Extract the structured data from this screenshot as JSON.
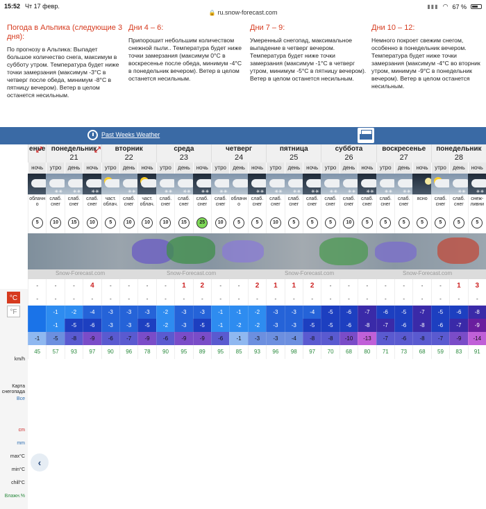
{
  "status": {
    "time": "15:52",
    "date": "Чт 17 февр.",
    "url": "ru.snow-forecast.com",
    "battery": "67 %",
    "battery_level": 0.67
  },
  "forecast": [
    {
      "title": "Погода в Альпика (следующие 3 дня):",
      "text": "По прогнозу в Альпика: Выпадет большое количество снега, максимум в субботу утром. Температура будет ниже точки замерзания (максимум -3°C в четверг после обеда, минимум -8°C в пятницу вечером). Ветер в целом останется несильным."
    },
    {
      "title": "Дни 4 – 6:",
      "text": "Припорошит небольшим количеством снежной пыли.. Температура будет ниже точки замерзания (максимум 0°C в воскресенье после обеда, минимум -4°C в понедельник вечером). Ветер в целом останется несильным."
    },
    {
      "title": "Дни 7 – 9:",
      "text": "Умеренный снегопад, максимальное выпадение в четверг вечером. Температура будет ниже точки замерзания (максимум -1°C в четверг утром, минимум -5°C в пятницу вечером). Ветер в целом останется несильным."
    },
    {
      "title": "Дни 10 – 12:",
      "text": "Немного покроет свежим снегом, особенно в понедельник вечером. Температура будет ниже точки замерзания (максимум -4°C во вторник утром, минимум -9°C в понедельник вечером). Ветер в целом останется несильным."
    }
  ],
  "bar": {
    "past_weeks": "Past Weeks Weather"
  },
  "units": {
    "c": "°C",
    "f": "°F"
  },
  "labels": {
    "wind": "km/h",
    "map": "Карта снегопада",
    "map_all": "Все",
    "snow_cm": "cm",
    "rain_mm": "mm",
    "tmax": "max°C",
    "tmin": "min°C",
    "chill": "chill°C",
    "humidity": "Влажн.%"
  },
  "snowfc_label": "Snow-Forecast.com",
  "days": [
    {
      "name": "енье",
      "num": ""
    },
    {
      "name": "понедельник",
      "num": "21"
    },
    {
      "name": "вторник",
      "num": "22"
    },
    {
      "name": "среда",
      "num": "23"
    },
    {
      "name": "четверг",
      "num": "24"
    },
    {
      "name": "пятница",
      "num": "25"
    },
    {
      "name": "суббота",
      "num": "26"
    },
    {
      "name": "воскресенье",
      "num": "27"
    },
    {
      "name": "понедельник",
      "num": "28"
    }
  ],
  "cols": [
    {
      "tod": "ночь",
      "desc": "облачн о",
      "wind": "5",
      "snow": "-",
      "mm": "-",
      "tmax": "",
      "tmin": "",
      "chill": "-1",
      "hum": "45",
      "kind": "night"
    },
    {
      "tod": "утро",
      "desc": "слаб. снег",
      "wind": "10",
      "snow": "-",
      "mm": "-",
      "tmax": "-1",
      "tmin": "-1",
      "chill": "-5",
      "hum": "57",
      "kind": "snow"
    },
    {
      "tod": "день",
      "desc": "слаб. снег",
      "wind": "15",
      "snow": "-",
      "mm": "-",
      "tmax": "-2",
      "tmin": "-5",
      "chill": "-8",
      "hum": "93",
      "kind": "snow"
    },
    {
      "tod": "ночь",
      "desc": "слаб. снег",
      "wind": "10",
      "snow": "4",
      "mm": "-",
      "tmax": "-4",
      "tmin": "-6",
      "chill": "-9",
      "hum": "97",
      "kind": "nightsnow"
    },
    {
      "tod": "утро",
      "desc": "част. облач.",
      "wind": "5",
      "snow": "-",
      "mm": "-",
      "tmax": "-3",
      "tmin": "-3",
      "chill": "-6",
      "hum": "90",
      "kind": "sun"
    },
    {
      "tod": "день",
      "desc": "слаб. снег",
      "wind": "10",
      "snow": "-",
      "mm": "-",
      "tmax": "-3",
      "tmin": "-3",
      "chill": "-7",
      "hum": "96",
      "kind": "snow"
    },
    {
      "tod": "ночь",
      "desc": "част. облач.",
      "wind": "10",
      "snow": "-",
      "mm": "-",
      "tmax": "-3",
      "tmin": "-5",
      "chill": "-9",
      "hum": "78",
      "kind": "nightsun"
    },
    {
      "tod": "утро",
      "desc": "слаб. снег",
      "wind": "10",
      "snow": "-",
      "mm": "-",
      "tmax": "-2",
      "tmin": "-2",
      "chill": "-6",
      "hum": "90",
      "kind": "snow"
    },
    {
      "tod": "день",
      "desc": "слаб. снег",
      "wind": "15",
      "snow": "1",
      "mm": "-",
      "tmax": "-3",
      "tmin": "-3",
      "chill": "-9",
      "hum": "95",
      "kind": "snow"
    },
    {
      "tod": "ночь",
      "desc": "слаб. снег",
      "wind": "25",
      "snow": "2",
      "mm": "-",
      "tmax": "-3",
      "tmin": "-5",
      "chill": "-9",
      "hum": "89",
      "kind": "nightsnow"
    },
    {
      "tod": "утро",
      "desc": "слаб. снег",
      "wind": "10",
      "snow": "-",
      "mm": "-",
      "tmax": "-1",
      "tmin": "-1",
      "chill": "-6",
      "hum": "95",
      "kind": "snow"
    },
    {
      "tod": "день",
      "desc": "облачн о",
      "wind": "5",
      "snow": "-",
      "mm": "-",
      "tmax": "-1",
      "tmin": "-2",
      "chill": "-1",
      "hum": "85",
      "kind": "cloud"
    },
    {
      "tod": "ночь",
      "desc": "слаб. снег",
      "wind": "5",
      "snow": "2",
      "mm": "-",
      "tmax": "-2",
      "tmin": "-2",
      "chill": "-3",
      "hum": "93",
      "kind": "nightsnow"
    },
    {
      "tod": "утро",
      "desc": "слаб. снег",
      "wind": "10",
      "snow": "1",
      "mm": "-",
      "tmax": "-3",
      "tmin": "-3",
      "chill": "-3",
      "hum": "96",
      "kind": "snow"
    },
    {
      "tod": "день",
      "desc": "слаб. снег",
      "wind": "5",
      "snow": "1",
      "mm": "-",
      "tmax": "-3",
      "tmin": "-3",
      "chill": "-4",
      "hum": "98",
      "kind": "snow"
    },
    {
      "tod": "ночь",
      "desc": "слаб. снег",
      "wind": "5",
      "snow": "2",
      "mm": "-",
      "tmax": "-4",
      "tmin": "-5",
      "chill": "-8",
      "hum": "97",
      "kind": "nightsnow"
    },
    {
      "tod": "утро",
      "desc": "слаб. снег",
      "wind": "5",
      "snow": "-",
      "mm": "-",
      "tmax": "-5",
      "tmin": "-5",
      "chill": "-8",
      "hum": "70",
      "kind": "snow"
    },
    {
      "tod": "день",
      "desc": "слаб. снег",
      "wind": "10",
      "snow": "-",
      "mm": "-",
      "tmax": "-6",
      "tmin": "-6",
      "chill": "-10",
      "hum": "68",
      "kind": "snow"
    },
    {
      "tod": "ночь",
      "desc": "слаб. снег",
      "wind": "5",
      "snow": "-",
      "mm": "-",
      "tmax": "-7",
      "tmin": "-8",
      "chill": "-13",
      "hum": "80",
      "kind": "nightsnow"
    },
    {
      "tod": "утро",
      "desc": "слаб. снег",
      "wind": "5",
      "snow": "-",
      "mm": "-",
      "tmax": "-6",
      "tmin": "-7",
      "chill": "-7",
      "hum": "71",
      "kind": "snow"
    },
    {
      "tod": "день",
      "desc": "слаб. снег",
      "wind": "5",
      "snow": "-",
      "mm": "-",
      "tmax": "-5",
      "tmin": "-6",
      "chill": "-6",
      "hum": "73",
      "kind": "snow"
    },
    {
      "tod": "ночь",
      "desc": "ясно",
      "wind": "5",
      "snow": "-",
      "mm": "-",
      "tmax": "-7",
      "tmin": "-8",
      "chill": "-8",
      "hum": "68",
      "kind": "clearnight"
    },
    {
      "tod": "утро",
      "desc": "слаб. снег",
      "wind": "5",
      "snow": "-",
      "mm": "-",
      "tmax": "-5",
      "tmin": "-6",
      "chill": "-7",
      "hum": "59",
      "kind": "sun"
    },
    {
      "tod": "день",
      "desc": "слаб. снег",
      "wind": "5",
      "snow": "1",
      "mm": "-",
      "tmax": "-6",
      "tmin": "-7",
      "chill": "-9",
      "hum": "83",
      "kind": "snow"
    },
    {
      "tod": "ночь",
      "desc": "снеж- ливни",
      "wind": "5",
      "snow": "3",
      "mm": "-",
      "tmax": "-8",
      "tmin": "-9",
      "chill": "-14",
      "hum": "91",
      "kind": "nightsnow"
    }
  ]
}
